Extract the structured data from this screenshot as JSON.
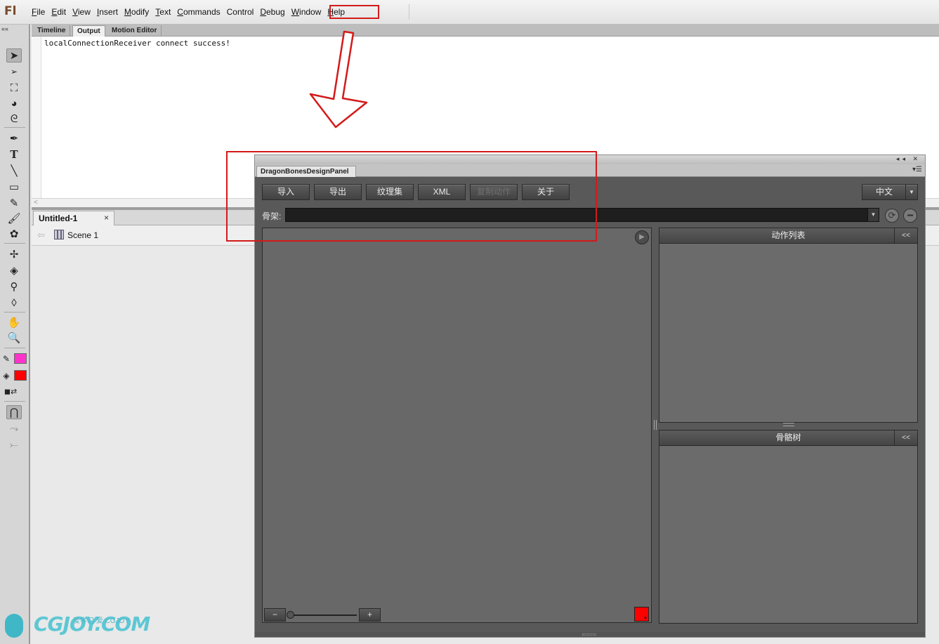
{
  "app": {
    "logo": "Fl"
  },
  "menu": {
    "items": [
      {
        "label": "File",
        "key": "F",
        "rest": "ile"
      },
      {
        "label": "Edit",
        "key": "E",
        "rest": "dit"
      },
      {
        "label": "View",
        "key": "V",
        "rest": "iew"
      },
      {
        "label": "Insert",
        "key": "I",
        "rest": "nsert"
      },
      {
        "label": "Modify",
        "key": "M",
        "rest": "odify"
      },
      {
        "label": "Text",
        "key": "T",
        "rest": "ext"
      },
      {
        "label": "Commands",
        "key": "C",
        "rest": "ommands"
      },
      {
        "label": "Control",
        "key": "",
        "rest": "Control"
      },
      {
        "label": "Debug",
        "key": "D",
        "rest": "ebug"
      },
      {
        "label": "Window",
        "key": "W",
        "rest": "indow"
      },
      {
        "label": "Help",
        "key": "H",
        "rest": "elp"
      }
    ]
  },
  "toolbar": {
    "collapse": "««",
    "tools": [
      "selection-tool",
      "subselection-tool",
      "free-transform-tool",
      "3d-rotation-tool",
      "lasso-tool",
      "pen-tool",
      "text-tool",
      "line-tool",
      "rectangle-tool",
      "pencil-tool",
      "brush-tool",
      "deco-tool",
      "bone-tool",
      "paint-bucket-tool",
      "eyedropper-tool",
      "eraser-tool",
      "hand-tool",
      "zoom-tool"
    ],
    "stroke_color": "#ff33cc",
    "fill_color": "#ff0000"
  },
  "output_panel": {
    "tabs": [
      "Timeline",
      "Output",
      "Motion Editor"
    ],
    "active_tab": "Output",
    "text": "localConnectionReceiver connect success!"
  },
  "document": {
    "tab": "Untitled-1",
    "close": "×",
    "scene": "Scene 1"
  },
  "dragonbones": {
    "title_buttons": "◂◂ ✕",
    "tab": "DragonBonesDesignPanel",
    "buttons": [
      "导入",
      "导出",
      "纹理集",
      "XML",
      "复制动作",
      "关于"
    ],
    "disabled_button_index": 4,
    "language": "中文",
    "skeleton_label": "骨架:",
    "skeleton_value": "",
    "animation_list_title": "动作列表",
    "bone_tree_title": "骨骼树",
    "collapse_label": "<<",
    "zoom_minus": "−",
    "zoom_plus": "+",
    "preview_color": "#ff0000"
  },
  "annotation": {
    "color": "#d41a1a"
  },
  "watermark": {
    "brand": "CGJOY.COM",
    "sub": "爱学习 爱 CGJOY"
  }
}
